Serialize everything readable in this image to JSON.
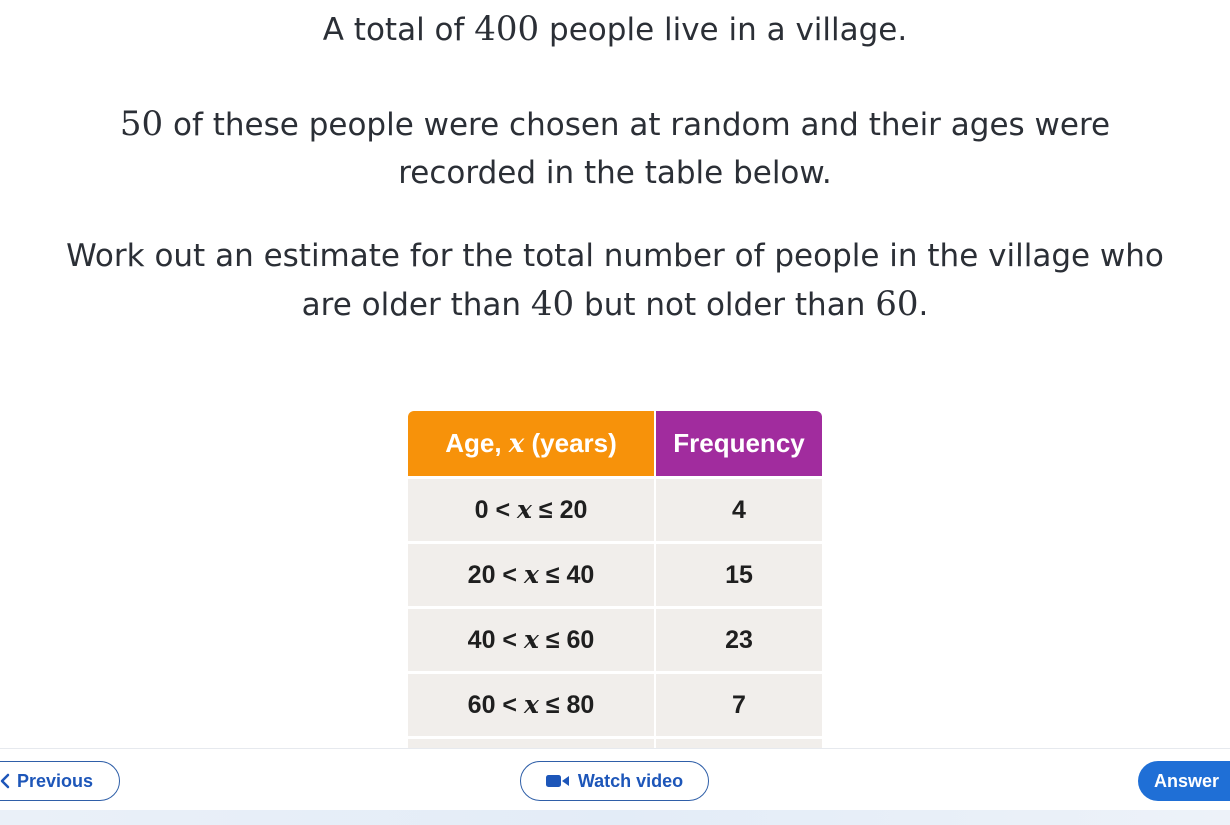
{
  "question": {
    "line1_a": "A total of ",
    "line1_num": "400",
    "line1_b": " people live in a village.",
    "line2_num": "50",
    "line2_a": " of these people were chosen at random and their ages were",
    "line3": "recorded in the table below.",
    "line4": "Work out an estimate for the total number of people in the village who",
    "line5_a": "are older than ",
    "line5_num1": "40",
    "line5_b": " but not older than ",
    "line5_num2": "60",
    "line5_c": "."
  },
  "table": {
    "header_age_prefix": "Age, ",
    "header_age_var": "x",
    "header_age_suffix": " (years)",
    "header_freq": "Frequency",
    "rows": [
      {
        "lower": "0",
        "upper": "20",
        "frequency": "4"
      },
      {
        "lower": "20",
        "upper": "40",
        "frequency": "15"
      },
      {
        "lower": "40",
        "upper": "60",
        "frequency": "23"
      },
      {
        "lower": "60",
        "upper": "80",
        "frequency": "7"
      }
    ],
    "var": "x",
    "lt": " < ",
    "le": " ≤ "
  },
  "nav": {
    "previous": "Previous",
    "watch_video": "Watch video",
    "answer": "Answer"
  },
  "colors": {
    "age_header": "#f7920a",
    "freq_header": "#a12c9e",
    "button_blue": "#1f6fd6"
  }
}
